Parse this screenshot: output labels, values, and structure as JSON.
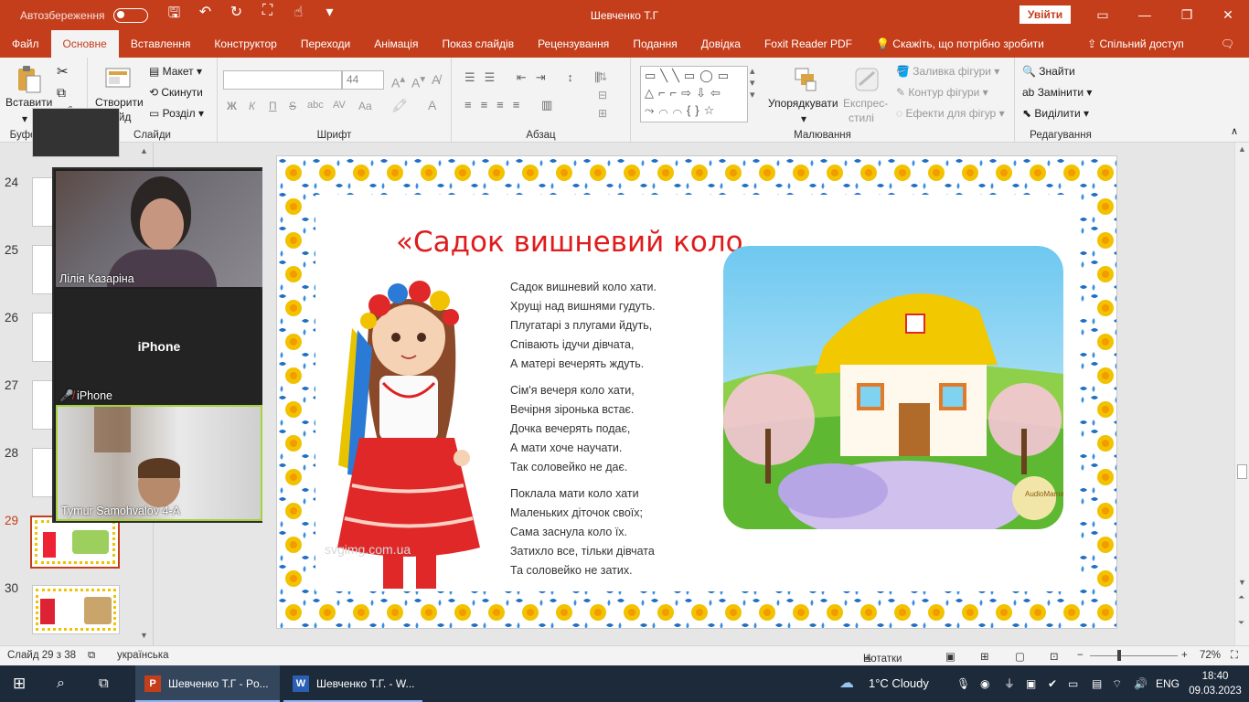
{
  "titlebar": {
    "autosave_label": "Автозбереження",
    "doc_title": "Шевченко Т.Г",
    "signin_label": "Увійти",
    "qat_icons": [
      "save-icon",
      "undo-icon",
      "redo-icon",
      "present-icon",
      "touch-icon",
      "customize-icon"
    ],
    "window_controls": [
      "ribbon-display-icon",
      "minimize-icon",
      "restore-icon",
      "close-icon"
    ]
  },
  "tabs": {
    "items": [
      "Файл",
      "Основне",
      "Вставлення",
      "Конструктор",
      "Переходи",
      "Анімація",
      "Показ слайдів",
      "Рецензування",
      "Подання",
      "Довідка",
      "Foxit Reader PDF"
    ],
    "active": "Основне",
    "tell_me": "Скажіть, що потрібно зробити",
    "share": "Спільний доступ"
  },
  "ribbon": {
    "clipboard": {
      "paste": "Вставити",
      "group_label": "Буфер обміну"
    },
    "slides": {
      "new_slide": "Створити",
      "new_slide2": "слайд",
      "layout": "Макет",
      "reset": "Скинути",
      "section": "Розділ",
      "group_label": "Слайди"
    },
    "font": {
      "font_name": "",
      "font_size": "44",
      "bold": "Ж",
      "italic": "К",
      "underline": "П",
      "strike": "S",
      "shadow": "abc",
      "spacing": "AV",
      "case": "Aa",
      "color": "A",
      "group_label": "Шрифт"
    },
    "paragraph": {
      "group_label": "Абзац"
    },
    "drawing": {
      "arrange": "Упорядкувати",
      "quick_styles": "Експрес-",
      "quick_styles2": "стилі",
      "fill": "Заливка фігури",
      "outline": "Контур фігури",
      "effects": "Ефекти для фігур",
      "group_label": "Малювання"
    },
    "editing": {
      "find": "Знайти",
      "replace": "Замінити",
      "select": "Виділити",
      "group_label": "Редагування"
    }
  },
  "thumbnails": {
    "numbers": [
      "24",
      "25",
      "26",
      "27",
      "28",
      "29",
      "30"
    ],
    "active": "29"
  },
  "zoom": {
    "participants": [
      {
        "name": "Лілія Казаріна"
      },
      {
        "name": "iPhone",
        "center_label": "iPhone"
      },
      {
        "name": "Tymur Samohvalov 4-А"
      }
    ]
  },
  "slide": {
    "title": "«Садок вишневий коло",
    "watermark": "svgimg.com.ua",
    "poem": [
      [
        "Садок вишневий коло хати.",
        "Хрущі над вишнями гудуть.",
        "Плугатарі з плугами йдуть,",
        "Співають ідучи дівчата,",
        "А матері вечерять ждуть."
      ],
      [
        "Сім'я вечеря коло хати,",
        "Вечірня зіронька встає.",
        "Дочка вечерять подає,",
        "А мати хоче научати.",
        "Так соловейко не дає."
      ],
      [
        "Поклала мати коло хати",
        "Маленьких діточок своїх;",
        "Сама заснула коло їх.",
        "Затихло все, тільки дівчата",
        "Та соловейко не затих."
      ]
    ],
    "image_badge": "AudioMama"
  },
  "status": {
    "slide_of": "Слайд 29 з 38",
    "language": "українська",
    "notes": "Нотатки",
    "zoom": "72%"
  },
  "taskbar": {
    "apps": [
      "Шевченко Т.Г - Po...",
      "Шевченко Т.Г. - W..."
    ],
    "weather": "1°C  Cloudy",
    "lang": "ENG",
    "time": "18:40",
    "date": "09.03.2023"
  },
  "colors": {
    "accent": "#c43e1c",
    "title_red": "#e01b1b",
    "taskbar": "#1d2a3a"
  }
}
